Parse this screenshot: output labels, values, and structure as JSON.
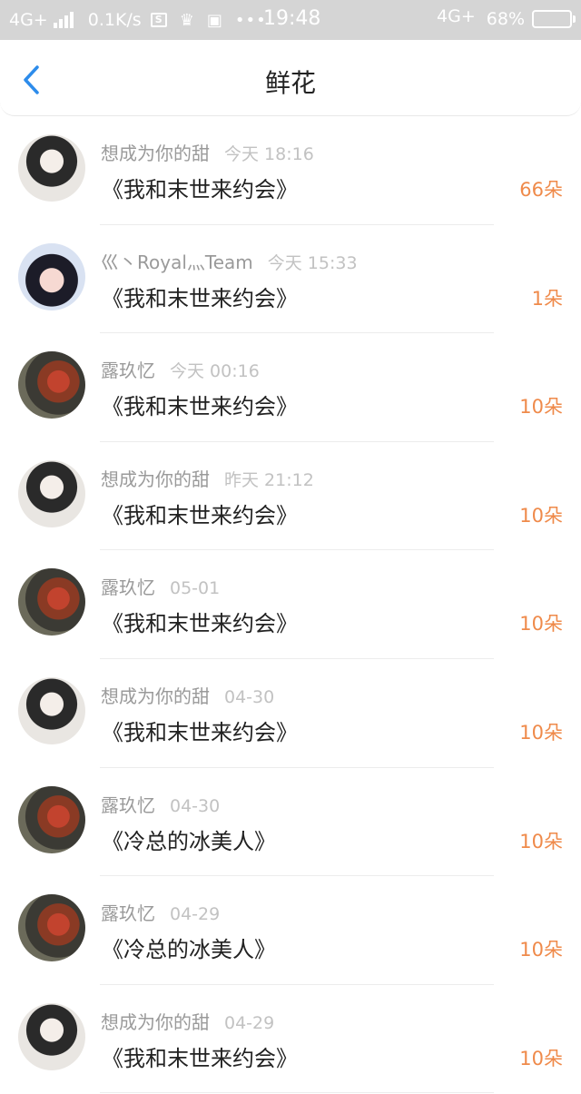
{
  "status_bar": {
    "network_left": "4G+",
    "speed": "0.1K/s",
    "time": "19:48",
    "network_right": "4G+",
    "battery": "68%",
    "icons": [
      "signal-icon",
      "s-box-icon",
      "crown-icon",
      "image-icon",
      "more-dots-icon"
    ]
  },
  "header": {
    "title": "鲜花",
    "back_icon": "chevron-left-icon",
    "accent_color": "#2d8ceb"
  },
  "colors": {
    "count": "#ef8a4a",
    "name": "#9a9a9a",
    "time": "#c2c2c2",
    "book": "#222222"
  },
  "records": [
    {
      "user": "想成为你的甜",
      "time": "今天 18:16",
      "book": "《我和末世来约会》",
      "count": "66朵",
      "avatar": "a-girl"
    },
    {
      "user": "巛丶Royal灬Team",
      "time": "今天 15:33",
      "book": "《我和末世来约会》",
      "count": "1朵",
      "avatar": "a-anime"
    },
    {
      "user": "露玖忆",
      "time": "今天 00:16",
      "book": "《我和末世来约会》",
      "count": "10朵",
      "avatar": "a-red"
    },
    {
      "user": "想成为你的甜",
      "time": "昨天 21:12",
      "book": "《我和末世来约会》",
      "count": "10朵",
      "avatar": "a-girl"
    },
    {
      "user": "露玖忆",
      "time": "05-01",
      "book": "《我和末世来约会》",
      "count": "10朵",
      "avatar": "a-red"
    },
    {
      "user": "想成为你的甜",
      "time": "04-30",
      "book": "《我和末世来约会》",
      "count": "10朵",
      "avatar": "a-girl"
    },
    {
      "user": "露玖忆",
      "time": "04-30",
      "book": "《冷总的冰美人》",
      "count": "10朵",
      "avatar": "a-red"
    },
    {
      "user": "露玖忆",
      "time": "04-29",
      "book": "《冷总的冰美人》",
      "count": "10朵",
      "avatar": "a-red"
    },
    {
      "user": "想成为你的甜",
      "time": "04-29",
      "book": "《我和末世来约会》",
      "count": "10朵",
      "avatar": "a-girl"
    }
  ]
}
